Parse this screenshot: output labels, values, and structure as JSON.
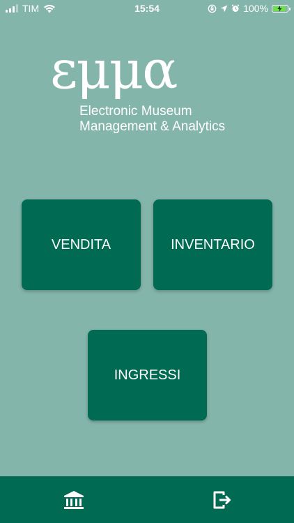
{
  "status_bar": {
    "carrier": "TIM",
    "time": "15:54",
    "battery": "100%",
    "icons": [
      "signal-icon",
      "wifi-icon",
      "lock-rotation-icon",
      "location-icon",
      "alarm-icon",
      "battery-icon"
    ]
  },
  "logo": {
    "wordmark": "εμμα",
    "subtitle_line1": "Electronic Museum",
    "subtitle_line2": "Management & Analytics"
  },
  "menu": {
    "vendita": "VENDITA",
    "inventario": "INVENTARIO",
    "ingressi": "INGRESSI"
  },
  "tab_bar": {
    "icons": [
      "museum-icon",
      "logout-icon"
    ]
  },
  "colors": {
    "background": "#84b5aa",
    "primary": "#006b52",
    "text": "#ffffff",
    "battery_fill": "#6fe04a"
  }
}
